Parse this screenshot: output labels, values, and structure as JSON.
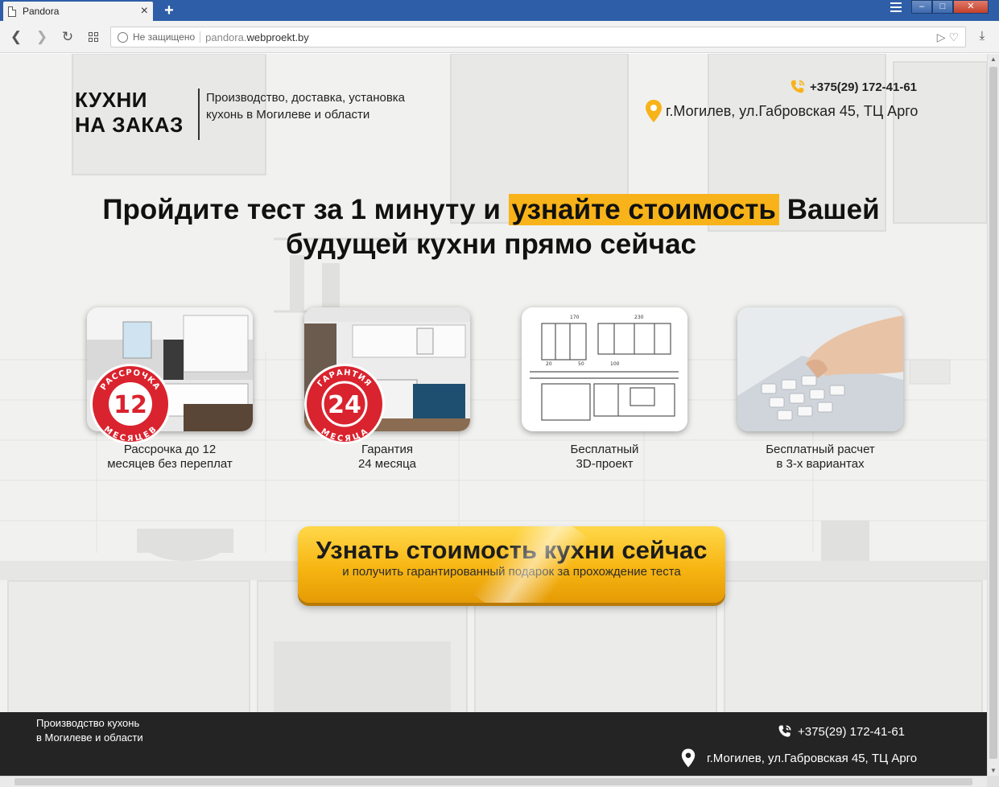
{
  "browser": {
    "tab_title": "Pandora",
    "new_tab": "+",
    "not_secure": "Не защищено",
    "url_sub": "pandora.",
    "url_domain": "webproekt.by"
  },
  "header": {
    "logo_line1": "КУХНИ",
    "logo_line2": "НА ЗАКАЗ",
    "tagline_line1": "Производство, доставка, установка",
    "tagline_line2": "кухонь в Могилеве и области",
    "phone": "+375(29) 172-41-61",
    "address": "г.Могилев, ул.Габровская 45, ТЦ Арго"
  },
  "hero": {
    "headline_part1": "Пройдите тест за 1 минуту и",
    "headline_highlight": "узнайте стоимость",
    "headline_part2": "Вашей будущей кухни прямо сейчас"
  },
  "features": [
    {
      "badge_number": "12",
      "badge_top": "РАССРОЧКА",
      "badge_bottom": "МЕСЯЦЕВ",
      "line1": "Рассрочка до 12",
      "line2": "месяцев без переплат"
    },
    {
      "badge_number": "24",
      "badge_top": "ГАРАНТИЯ",
      "badge_bottom": "МЕСЯЦА",
      "line1": "Гарантия",
      "line2": "24 месяца"
    },
    {
      "line1": "Бесплатный",
      "line2": "3D-проект"
    },
    {
      "line1": "Бесплатный расчет",
      "line2": "в 3-х вариантах"
    }
  ],
  "cta": {
    "title": "Узнать стоимость кухни сейчас",
    "subtitle": "и получить гарантированный подарок за прохождение теста"
  },
  "footer": {
    "line1": "Производство кухонь",
    "line2": "в Могилеве и области",
    "phone": "+375(29) 172-41-61",
    "address": "г.Могилев, ул.Габровская 45, ТЦ Арго"
  },
  "colors": {
    "accent": "#f7b319",
    "badge_red": "#d9232e",
    "footer_bg": "#242424",
    "tab_bar": "#2e5ea8"
  },
  "icons": [
    "document-icon",
    "close-icon",
    "plus-icon",
    "menu-icon",
    "back-icon",
    "forward-icon",
    "reload-icon",
    "speed-dial-icon",
    "globe-icon",
    "send-icon",
    "heart-icon",
    "download-icon",
    "phone-icon",
    "location-pin-icon"
  ]
}
